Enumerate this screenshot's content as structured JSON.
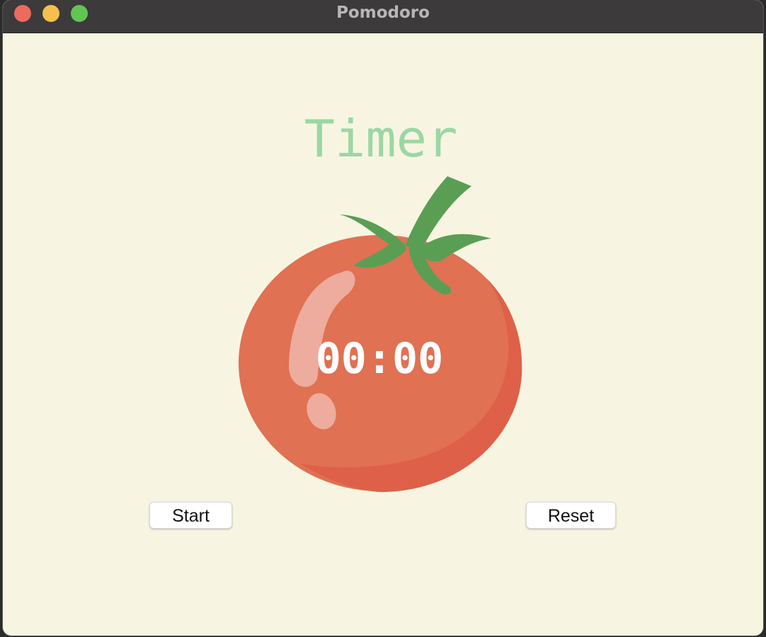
{
  "window": {
    "title": "Pomodoro"
  },
  "main": {
    "heading": "Timer",
    "timer": "00:00",
    "start_label": "Start",
    "reset_label": "Reset"
  },
  "icons": {
    "tomato": "tomato-icon"
  },
  "colors": {
    "background": "#f7f5e1",
    "heading": "#9bd7a4",
    "tomato": "#e07152",
    "leaves": "#5a9e54",
    "timer_text": "#ffffff"
  }
}
